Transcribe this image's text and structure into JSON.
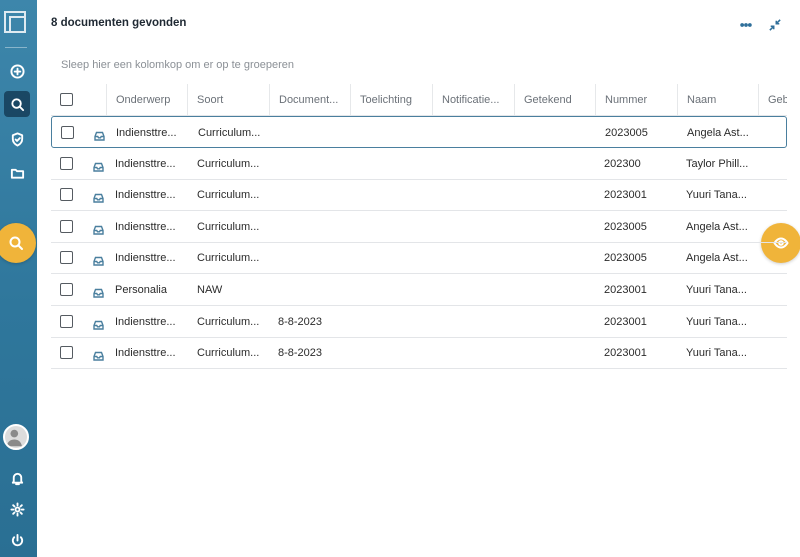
{
  "header": {
    "result_title": "8 documenten gevonden",
    "more_icon": "more-horizontal-icon",
    "collapse_icon": "collapse-icon"
  },
  "group_hint": "Sleep hier een kolomkop om er op te groeperen",
  "columns": [
    "Onderwerp",
    "Soort",
    "Document...",
    "Toelichting",
    "Notificatie...",
    "Getekend",
    "Nummer",
    "Naam",
    "Geb"
  ],
  "rows": [
    {
      "onderwerp": "Indiensttre...",
      "soort": "Curriculum...",
      "document": "",
      "toelichting": "",
      "notificatie": "",
      "getekend": "",
      "nummer": "2023005",
      "naam": "Angela Ast..."
    },
    {
      "onderwerp": "Indiensttre...",
      "soort": "Curriculum...",
      "document": "",
      "toelichting": "",
      "notificatie": "",
      "getekend": "",
      "nummer": "202300",
      "naam": "Taylor Phill..."
    },
    {
      "onderwerp": "Indiensttre...",
      "soort": "Curriculum...",
      "document": "",
      "toelichting": "",
      "notificatie": "",
      "getekend": "",
      "nummer": "2023001",
      "naam": "Yuuri Tana..."
    },
    {
      "onderwerp": "Indiensttre...",
      "soort": "Curriculum...",
      "document": "",
      "toelichting": "",
      "notificatie": "",
      "getekend": "",
      "nummer": "2023005",
      "naam": "Angela Ast..."
    },
    {
      "onderwerp": "Indiensttre...",
      "soort": "Curriculum...",
      "document": "",
      "toelichting": "",
      "notificatie": "",
      "getekend": "",
      "nummer": "2023005",
      "naam": "Angela Ast..."
    },
    {
      "onderwerp": "Personalia",
      "soort": "NAW",
      "document": "",
      "toelichting": "",
      "notificatie": "",
      "getekend": "",
      "nummer": "2023001",
      "naam": "Yuuri Tana..."
    },
    {
      "onderwerp": "Indiensttre...",
      "soort": "Curriculum...",
      "document": "8-8-2023",
      "toelichting": "",
      "notificatie": "",
      "getekend": "",
      "nummer": "2023001",
      "naam": "Yuuri Tana..."
    },
    {
      "onderwerp": "Indiensttre...",
      "soort": "Curriculum...",
      "document": "8-8-2023",
      "toelichting": "",
      "notificatie": "",
      "getekend": "",
      "nummer": "2023001",
      "naam": "Yuuri Tana..."
    }
  ],
  "sidebar": {
    "items": [
      "add-icon",
      "search-icon",
      "shield-icon",
      "folder-icon"
    ],
    "bottom": [
      "bell-icon",
      "gear-icon",
      "power-icon"
    ]
  },
  "colors": {
    "sidebar": "#2f779c",
    "accent": "#f0b43a",
    "selected_border": "#4a7f9e"
  }
}
